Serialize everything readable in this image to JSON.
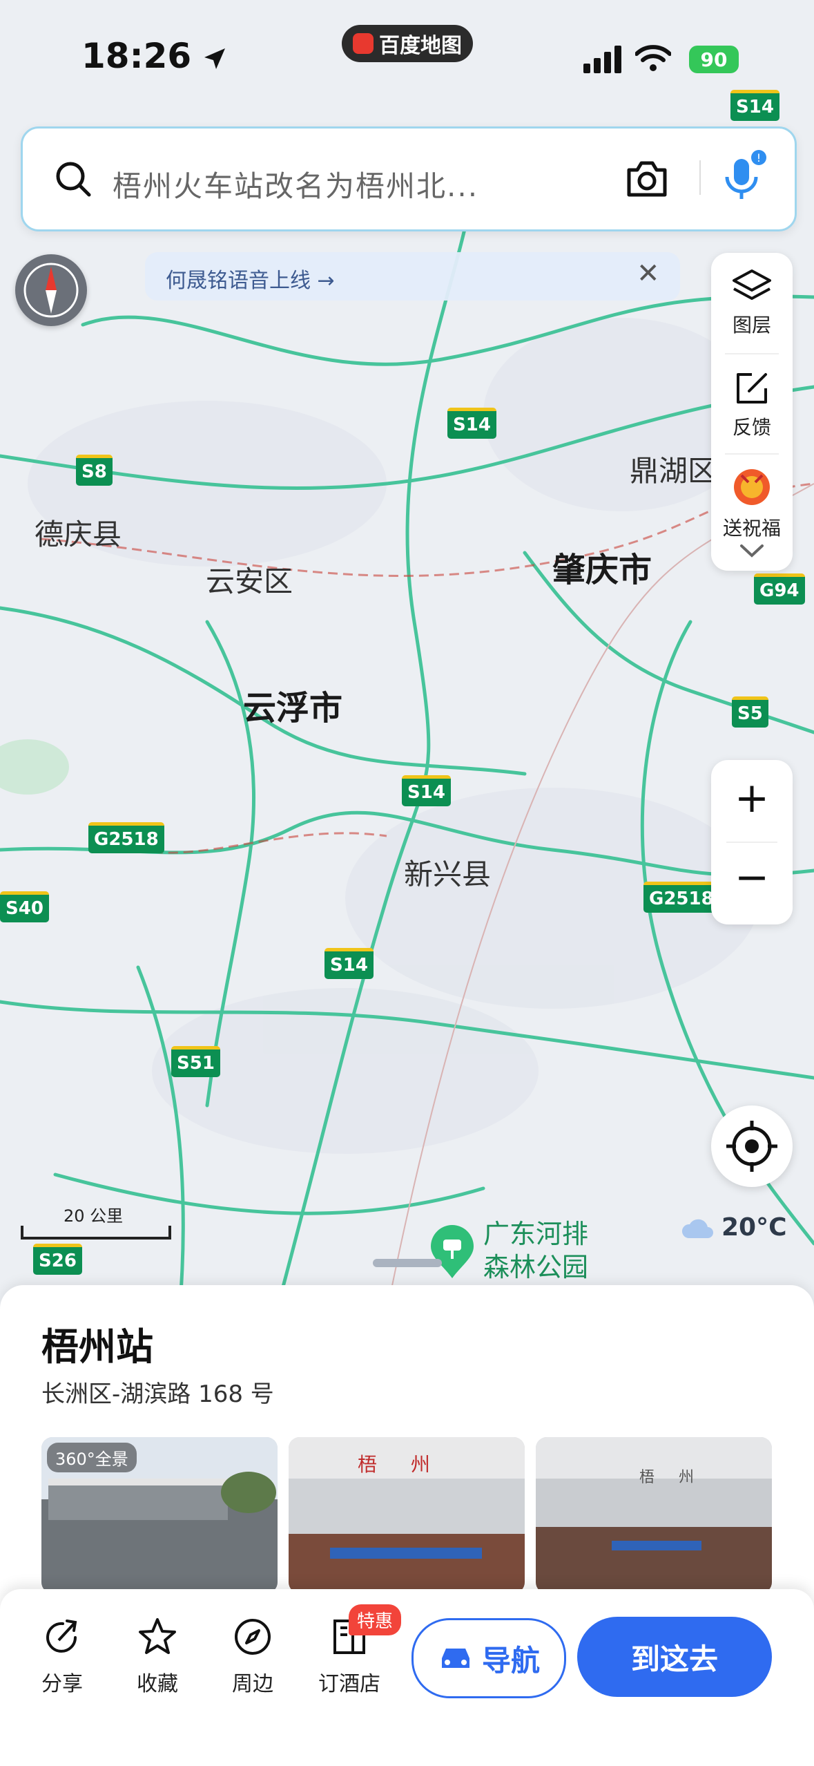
{
  "status_bar": {
    "time": "18:26",
    "battery": "90"
  },
  "app_pill": {
    "label": "百度地图"
  },
  "search": {
    "placeholder": "梧州火车站改名为梧州北..."
  },
  "notice": {
    "text": "何晟铭语音上线 →",
    "close": "✕"
  },
  "side_panel": {
    "layers": "图层",
    "feedback": "反馈",
    "blessing": "送祝福"
  },
  "zoom": {
    "in": "+",
    "out": "−"
  },
  "map": {
    "cities": [
      "肇庆市",
      "云浮市"
    ],
    "counties": [
      "德庆县",
      "云安区",
      "新兴县",
      "鼎湖区"
    ],
    "roads": [
      "S14",
      "S8",
      "G94",
      "S5",
      "S14",
      "G2518",
      "G2518",
      "S14",
      "S51",
      "S26",
      "S40",
      "S14"
    ],
    "scale": "20 公里",
    "poi": "广东河排森林公园",
    "weather": "20°C"
  },
  "poi": {
    "name": "梧州站",
    "address": "长洲区-湖滨路 168 号",
    "photos": [
      {
        "tag": "360°全景"
      },
      {
        "sign": "梧 州"
      },
      {
        "sign": "梧 州"
      }
    ]
  },
  "actions": {
    "share": "分享",
    "favorite": "收藏",
    "nearby": "周边",
    "hotel": "订酒店",
    "hotel_badge": "特惠"
  },
  "buttons": {
    "navigate": "导航",
    "go_here": "到这去"
  },
  "colors": {
    "accent": "#2f6bf0",
    "road_green": "#3cc49a",
    "badge_red": "#f2443a"
  }
}
